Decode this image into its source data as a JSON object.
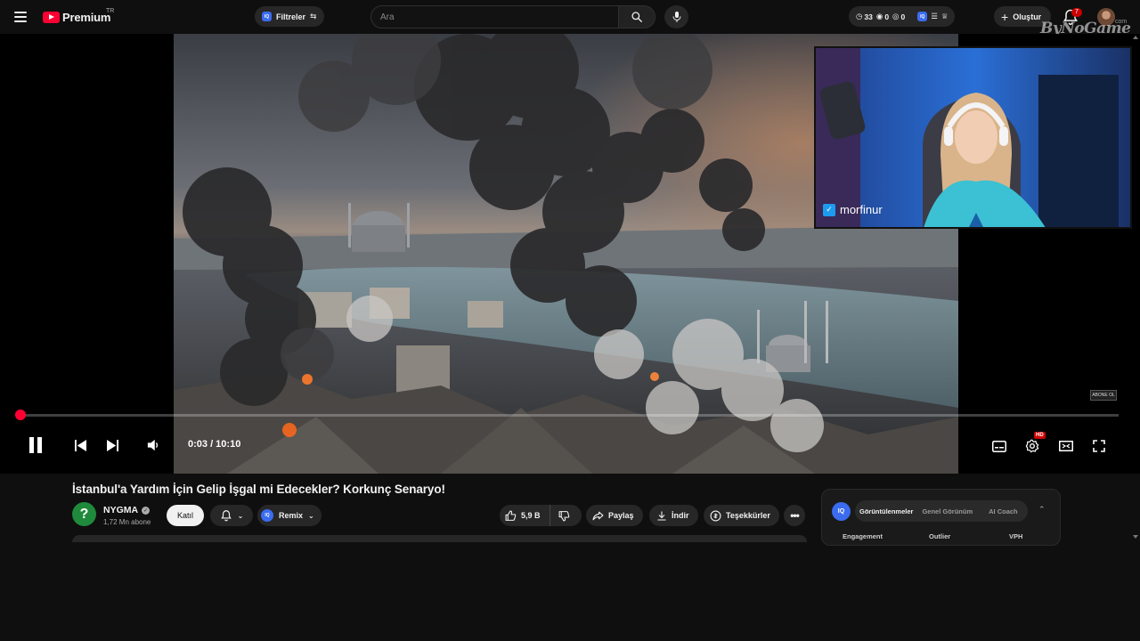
{
  "masthead": {
    "logo_text": "Premium",
    "logo_country": "TR",
    "filter_label": "Filtreler",
    "iq_label": "IQ",
    "search_placeholder": "Ara",
    "stats": {
      "views": "33",
      "likes": "0",
      "comments": "0"
    },
    "create_label": "Oluştur",
    "notification_count": "7",
    "watermark": "ByNoGame",
    "watermark_suffix": "com"
  },
  "player": {
    "current_time": "0:03",
    "duration": "10:10",
    "time_display": "0:03 / 10:10",
    "progress": 0.005,
    "hd_label": "HD",
    "webcam_handle": "morfinur",
    "webcam_button": "ABONE OL"
  },
  "video": {
    "title": "İstanbul'a Yardım İçin Gelip İşgal mi Edecekler? Korkunç Senaryo!",
    "channel": "NYGMA",
    "subscribers": "1,72 Mn abone",
    "join_label": "Katıl",
    "remix_label": "Remix",
    "likes": "5,9 B",
    "share_label": "Paylaş",
    "download_label": "İndir",
    "thanks_label": "Teşekkürler"
  },
  "side_panel": {
    "iq_label": "IQ",
    "tabs": [
      "Görüntülenmeler",
      "Genel Görünüm",
      "AI Coach"
    ],
    "columns": [
      "Engagement",
      "Outlier",
      "VPH"
    ]
  },
  "colors": {
    "background": "#0f0f0f",
    "accent_red": "#ff0033",
    "iq_blue": "#3b6cf0",
    "pill_bg": "#272727"
  }
}
